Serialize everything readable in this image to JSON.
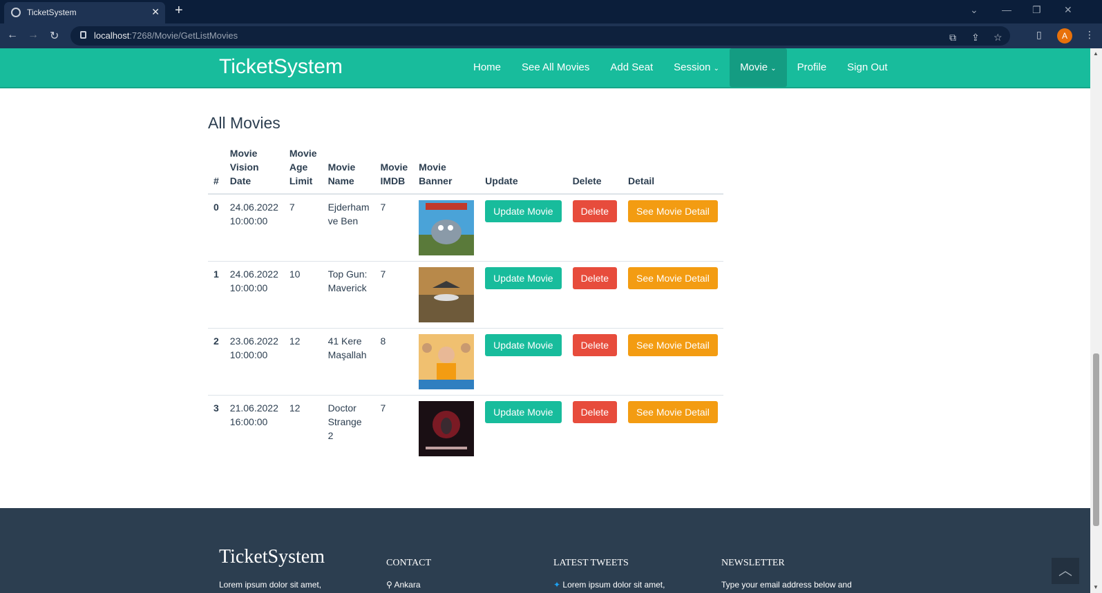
{
  "browser": {
    "tab_title": "TicketSystem",
    "url_host": "localhost",
    "url_rest": ":7268/Movie/GetListMovies",
    "avatar_letter": "A"
  },
  "nav": {
    "brand": "TicketSystem",
    "links": [
      "Home",
      "See All Movies",
      "Add Seat",
      "Session",
      "Movie",
      "Profile",
      "Sign Out"
    ],
    "active": "Movie"
  },
  "page": {
    "heading": "All Movies",
    "columns": [
      "#",
      "Movie Vision Date",
      "Movie Age Limit",
      "Movie Name",
      "Movie IMDB",
      "Movie Banner",
      "Update",
      "Delete",
      "Detail"
    ],
    "rows": [
      {
        "index": "0",
        "date": "24.06.2022 10:00:00",
        "age": "7",
        "name": "Ejderham ve Ben",
        "imdb": "7"
      },
      {
        "index": "1",
        "date": "24.06.2022 10:00:00",
        "age": "10",
        "name": "Top Gun: Maverick",
        "imdb": "7"
      },
      {
        "index": "2",
        "date": "23.06.2022 10:00:00",
        "age": "12",
        "name": "41 Kere Maşallah",
        "imdb": "8"
      },
      {
        "index": "3",
        "date": "21.06.2022 16:00:00",
        "age": "12",
        "name": "Doctor Strange 2",
        "imdb": "7"
      }
    ],
    "buttons": {
      "update": "Update Movie",
      "delete": "Delete",
      "detail": "See Movie Detail"
    }
  },
  "footer": {
    "brand": "TicketSystem",
    "brand_text": "Lorem ipsum dolor sit amet,",
    "contact_title": "CONTACT",
    "contact_city": "Ankara",
    "tweets_title": "LATEST TWEETS",
    "tweet_text": "Lorem ipsum dolor sit amet,",
    "newsletter_title": "NEWSLETTER",
    "newsletter_text": "Type your email address below and"
  },
  "colors": {
    "primary": "#18bc9c",
    "danger": "#e74c3c",
    "warning": "#f39c12",
    "dark": "#2c3e50"
  }
}
